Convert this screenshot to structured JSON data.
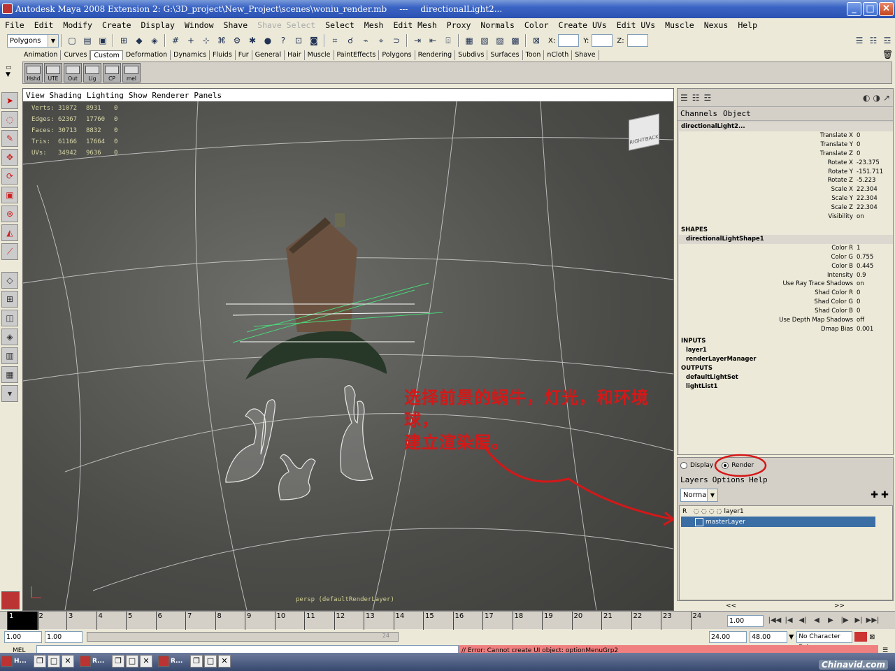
{
  "window": {
    "title": "Autodesk Maya 2008 Extension 2: G:\\3D_project\\New_Project\\scenes\\woniu_render.mb",
    "separator": "---",
    "subtitle": "directionalLight2..."
  },
  "menubar": {
    "items": [
      "File",
      "Edit",
      "Modify",
      "Create",
      "Display",
      "Window",
      "Shave",
      "Shave Select",
      "Select",
      "Mesh",
      "Edit Mesh",
      "Proxy",
      "Normals",
      "Color",
      "Create UVs",
      "Edit UVs",
      "Muscle",
      "Nexus",
      "Help"
    ],
    "disabled": [
      "Shave Select"
    ]
  },
  "toolbar": {
    "mode": "Polygons",
    "x_label": "X:",
    "y_label": "Y:",
    "z_label": "Z:"
  },
  "shelf": {
    "tabs": [
      "Animation",
      "Curves",
      "Custom",
      "Deformation",
      "Dynamics",
      "Fluids",
      "Fur",
      "General",
      "Hair",
      "Muscle",
      "PaintEffects",
      "Polygons",
      "Rendering",
      "Subdivs",
      "Surfaces",
      "Toon",
      "nCloth",
      "Shave"
    ],
    "active": "Custom",
    "buttons": [
      "Hshd",
      "UTE",
      "Out",
      "Lig",
      "CP",
      "mel"
    ]
  },
  "viewport": {
    "menu": [
      "View",
      "Shading",
      "Lighting",
      "Show",
      "Renderer",
      "Panels"
    ],
    "hud": [
      {
        "label": "Verts:",
        "a": "31072",
        "b": "8931",
        "c": "0"
      },
      {
        "label": "Edges:",
        "a": "62367",
        "b": "17760",
        "c": "0"
      },
      {
        "label": "Faces:",
        "a": "30713",
        "b": "8832",
        "c": "0"
      },
      {
        "label": "Tris:",
        "a": "61166",
        "b": "17664",
        "c": "0"
      },
      {
        "label": "UVs:",
        "a": "34942",
        "b": "9636",
        "c": "0"
      }
    ],
    "camera": "persp (defaultRenderLayer)",
    "viewcube": {
      "right": "RIGHT",
      "back": "BACK"
    },
    "annotation_line1": "选择前景的蜗牛，灯光，和环境球，",
    "annotation_line2": "建立渲染层。"
  },
  "channelbox": {
    "menu": [
      "Channels",
      "Object"
    ],
    "node": "directionalLight2...",
    "attrs": [
      {
        "n": "Translate X",
        "v": "0"
      },
      {
        "n": "Translate Y",
        "v": "0"
      },
      {
        "n": "Translate Z",
        "v": "0"
      },
      {
        "n": "Rotate X",
        "v": "-23.375"
      },
      {
        "n": "Rotate Y",
        "v": "-151.711"
      },
      {
        "n": "Rotate Z",
        "v": "-5.223"
      },
      {
        "n": "Scale X",
        "v": "22.304"
      },
      {
        "n": "Scale Y",
        "v": "22.304"
      },
      {
        "n": "Scale Z",
        "v": "22.304"
      },
      {
        "n": "Visibility",
        "v": "on"
      }
    ],
    "shapes_label": "SHAPES",
    "shape": "directionalLightShape1",
    "shape_attrs": [
      {
        "n": "Color R",
        "v": "1"
      },
      {
        "n": "Color G",
        "v": "0.755"
      },
      {
        "n": "Color B",
        "v": "0.445"
      },
      {
        "n": "Intensity",
        "v": "0.9"
      },
      {
        "n": "Use Ray Trace Shadows",
        "v": "on"
      },
      {
        "n": "Shad Color R",
        "v": "0"
      },
      {
        "n": "Shad Color G",
        "v": "0"
      },
      {
        "n": "Shad Color B",
        "v": "0"
      },
      {
        "n": "Use Depth Map Shadows",
        "v": "off"
      },
      {
        "n": "Dmap Bias",
        "v": "0.001"
      }
    ],
    "inputs_label": "INPUTS",
    "inputs": [
      "layer1",
      "renderLayerManager"
    ],
    "outputs_label": "OUTPUTS",
    "outputs": [
      "defaultLightSet",
      "lightList1"
    ]
  },
  "layers": {
    "display_label": "Display",
    "render_label": "Render",
    "menu": [
      "Layers",
      "Options",
      "Help"
    ],
    "blend": "Normal",
    "rows": [
      {
        "r": "R",
        "name": "layer1"
      },
      {
        "r": "",
        "name": "masterLayer"
      }
    ]
  },
  "timeline": {
    "ticks": [
      "1",
      "2",
      "3",
      "4",
      "5",
      "6",
      "7",
      "8",
      "9",
      "10",
      "11",
      "12",
      "13",
      "14",
      "15",
      "16",
      "17",
      "18",
      "19",
      "20",
      "21",
      "22",
      "23",
      "24"
    ],
    "current": "1.00"
  },
  "range": {
    "start": "1.00",
    "start2": "1.00",
    "slider_end": "24",
    "end": "24.00",
    "end2": "48.00",
    "character": "No Character Set"
  },
  "cmd": {
    "label": "MEL",
    "error": "// Error: Cannot create UI object: optionMenuGrp2"
  },
  "taskbar": {
    "items": [
      "H...",
      "R...",
      "R..."
    ]
  },
  "watermark": "Chinavid.com",
  "colors": {
    "annotation": "#d41818",
    "selection": "#3a6ea5",
    "error": "#f08080"
  }
}
